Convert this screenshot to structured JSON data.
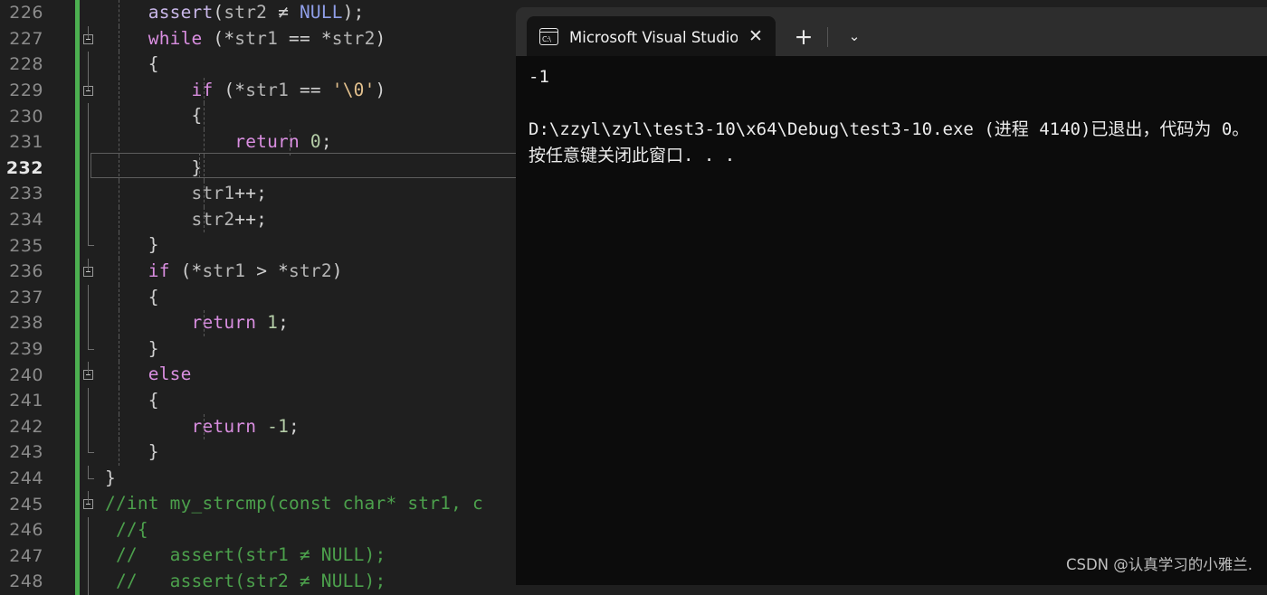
{
  "editor": {
    "first_line_number": 226,
    "current_line": 232,
    "lines": [
      {
        "n": 226,
        "fold": "none",
        "indent_guides": [
          0
        ],
        "tokens": [
          {
            "t": "    ",
            "c": "punc"
          },
          {
            "t": "assert",
            "c": "fn"
          },
          {
            "t": "(",
            "c": "punc"
          },
          {
            "t": "str2",
            "c": "id"
          },
          {
            "t": " ≠ ",
            "c": "punc"
          },
          {
            "t": "NULL",
            "c": "macro"
          },
          {
            "t": ");",
            "c": "punc"
          }
        ]
      },
      {
        "n": 227,
        "fold": "mark",
        "indent_guides": [
          0
        ],
        "tokens": [
          {
            "t": "    ",
            "c": "punc"
          },
          {
            "t": "while",
            "c": "kw"
          },
          {
            "t": " (*",
            "c": "punc"
          },
          {
            "t": "str1",
            "c": "id"
          },
          {
            "t": " == *",
            "c": "punc"
          },
          {
            "t": "str2",
            "c": "id"
          },
          {
            "t": ")",
            "c": "punc"
          }
        ]
      },
      {
        "n": 228,
        "fold": "line",
        "indent_guides": [
          0
        ],
        "tokens": [
          {
            "t": "    {",
            "c": "punc"
          }
        ]
      },
      {
        "n": 229,
        "fold": "mark",
        "indent_guides": [
          0,
          1
        ],
        "tokens": [
          {
            "t": "        ",
            "c": "punc"
          },
          {
            "t": "if",
            "c": "kw"
          },
          {
            "t": " (*",
            "c": "punc"
          },
          {
            "t": "str1",
            "c": "id"
          },
          {
            "t": " == ",
            "c": "punc"
          },
          {
            "t": "'\\0'",
            "c": "str"
          },
          {
            "t": ")",
            "c": "punc"
          }
        ]
      },
      {
        "n": 230,
        "fold": "line",
        "indent_guides": [
          0,
          1
        ],
        "tokens": [
          {
            "t": "        {",
            "c": "punc"
          }
        ]
      },
      {
        "n": 231,
        "fold": "line",
        "indent_guides": [
          0,
          1,
          2
        ],
        "tokens": [
          {
            "t": "            ",
            "c": "punc"
          },
          {
            "t": "return",
            "c": "kw"
          },
          {
            "t": " ",
            "c": "punc"
          },
          {
            "t": "0",
            "c": "num"
          },
          {
            "t": ";",
            "c": "punc"
          }
        ]
      },
      {
        "n": 232,
        "fold": "line",
        "indent_guides": [
          0,
          1
        ],
        "tokens": [
          {
            "t": "        }",
            "c": "punc"
          }
        ]
      },
      {
        "n": 233,
        "fold": "line",
        "indent_guides": [
          0,
          1
        ],
        "tokens": [
          {
            "t": "        ",
            "c": "punc"
          },
          {
            "t": "str1",
            "c": "id"
          },
          {
            "t": "++;",
            "c": "punc"
          }
        ]
      },
      {
        "n": 234,
        "fold": "line",
        "indent_guides": [
          0,
          1
        ],
        "tokens": [
          {
            "t": "        ",
            "c": "punc"
          },
          {
            "t": "str2",
            "c": "id"
          },
          {
            "t": "++;",
            "c": "punc"
          }
        ]
      },
      {
        "n": 235,
        "fold": "endline",
        "indent_guides": [
          0
        ],
        "tokens": [
          {
            "t": "    }",
            "c": "punc"
          }
        ]
      },
      {
        "n": 236,
        "fold": "mark",
        "indent_guides": [
          0
        ],
        "tokens": [
          {
            "t": "    ",
            "c": "punc"
          },
          {
            "t": "if",
            "c": "kw"
          },
          {
            "t": " (*",
            "c": "punc"
          },
          {
            "t": "str1",
            "c": "id"
          },
          {
            "t": " > *",
            "c": "punc"
          },
          {
            "t": "str2",
            "c": "id"
          },
          {
            "t": ")",
            "c": "punc"
          }
        ]
      },
      {
        "n": 237,
        "fold": "line",
        "indent_guides": [
          0
        ],
        "tokens": [
          {
            "t": "    {",
            "c": "punc"
          }
        ]
      },
      {
        "n": 238,
        "fold": "line",
        "indent_guides": [
          0,
          1
        ],
        "tokens": [
          {
            "t": "        ",
            "c": "punc"
          },
          {
            "t": "return",
            "c": "kw"
          },
          {
            "t": " ",
            "c": "punc"
          },
          {
            "t": "1",
            "c": "num"
          },
          {
            "t": ";",
            "c": "punc"
          }
        ]
      },
      {
        "n": 239,
        "fold": "endline",
        "indent_guides": [
          0
        ],
        "tokens": [
          {
            "t": "    }",
            "c": "punc"
          }
        ]
      },
      {
        "n": 240,
        "fold": "mark",
        "indent_guides": [
          0
        ],
        "tokens": [
          {
            "t": "    ",
            "c": "punc"
          },
          {
            "t": "else",
            "c": "kw"
          }
        ]
      },
      {
        "n": 241,
        "fold": "line",
        "indent_guides": [
          0
        ],
        "tokens": [
          {
            "t": "    {",
            "c": "punc"
          }
        ]
      },
      {
        "n": 242,
        "fold": "line",
        "indent_guides": [
          0,
          1
        ],
        "tokens": [
          {
            "t": "        ",
            "c": "punc"
          },
          {
            "t": "return",
            "c": "kw"
          },
          {
            "t": " ",
            "c": "punc"
          },
          {
            "t": "-1",
            "c": "num"
          },
          {
            "t": ";",
            "c": "punc"
          }
        ]
      },
      {
        "n": 243,
        "fold": "endline",
        "indent_guides": [
          0
        ],
        "tokens": [
          {
            "t": "    }",
            "c": "punc"
          }
        ]
      },
      {
        "n": 244,
        "fold": "endline",
        "indent_guides": [],
        "tokens": [
          {
            "t": "}",
            "c": "punc"
          }
        ]
      },
      {
        "n": 245,
        "fold": "mark",
        "indent_guides": [],
        "tokens": [
          {
            "t": "//int my_strcmp(const char* str1, c",
            "c": "cmt"
          }
        ]
      },
      {
        "n": 246,
        "fold": "line",
        "indent_guides": [],
        "tokens": [
          {
            "t": " //{",
            "c": "cmt"
          }
        ]
      },
      {
        "n": 247,
        "fold": "line",
        "indent_guides": [],
        "tokens": [
          {
            "t": " //   assert(str1 ≠ NULL);",
            "c": "cmt"
          }
        ]
      },
      {
        "n": 248,
        "fold": "line",
        "indent_guides": [],
        "tokens": [
          {
            "t": " //   assert(str2 ≠ NULL);",
            "c": "cmt"
          }
        ]
      }
    ]
  },
  "terminal": {
    "tab": {
      "title": "Microsoft Visual Studio 调试控",
      "icon": "command-prompt-icon",
      "close_label": "✕"
    },
    "new_tab_label": "+",
    "dropdown_label": "⌄",
    "output_lines": [
      "-1",
      "",
      "D:\\zzyl\\zyl\\test3-10\\x64\\Debug\\test3-10.exe (进程 4140)已退出，代码为 0。",
      "按任意键关闭此窗口. . ."
    ]
  },
  "watermark": {
    "text": "CSDN @认真学习的小雅兰."
  },
  "colors": {
    "editor_bg": "#1f1f1f",
    "terminal_bg": "#0c0c0c",
    "titlebar_bg": "#2d2d2d",
    "change_bar": "#4caf50",
    "keyword": "#d98ee0",
    "comment": "#4ca04c",
    "number": "#b5cea8",
    "string": "#e2c08d",
    "macro": "#8f9ee8"
  }
}
